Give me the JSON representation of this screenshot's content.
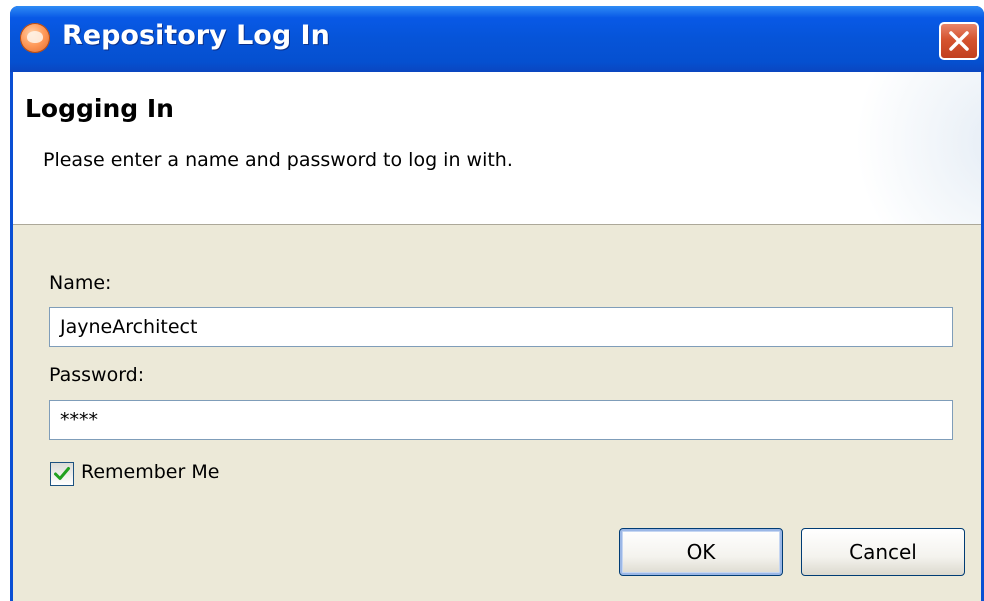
{
  "window": {
    "title": "Repository Log In",
    "icon": "app-logo-icon",
    "close_icon": "close-icon"
  },
  "banner": {
    "title": "Logging In",
    "description": "Please enter a name and password to log in with."
  },
  "form": {
    "name_label": "Name:",
    "name_value": "JayneArchitect",
    "password_label": "Password:",
    "password_value": "****",
    "remember_label": "Remember Me",
    "remember_checked": true
  },
  "buttons": {
    "ok": "OK",
    "cancel": "Cancel"
  },
  "colors": {
    "titlebar": "#0654d8",
    "dialog_background": "#ece9d8",
    "close_button": "#d5532f"
  }
}
